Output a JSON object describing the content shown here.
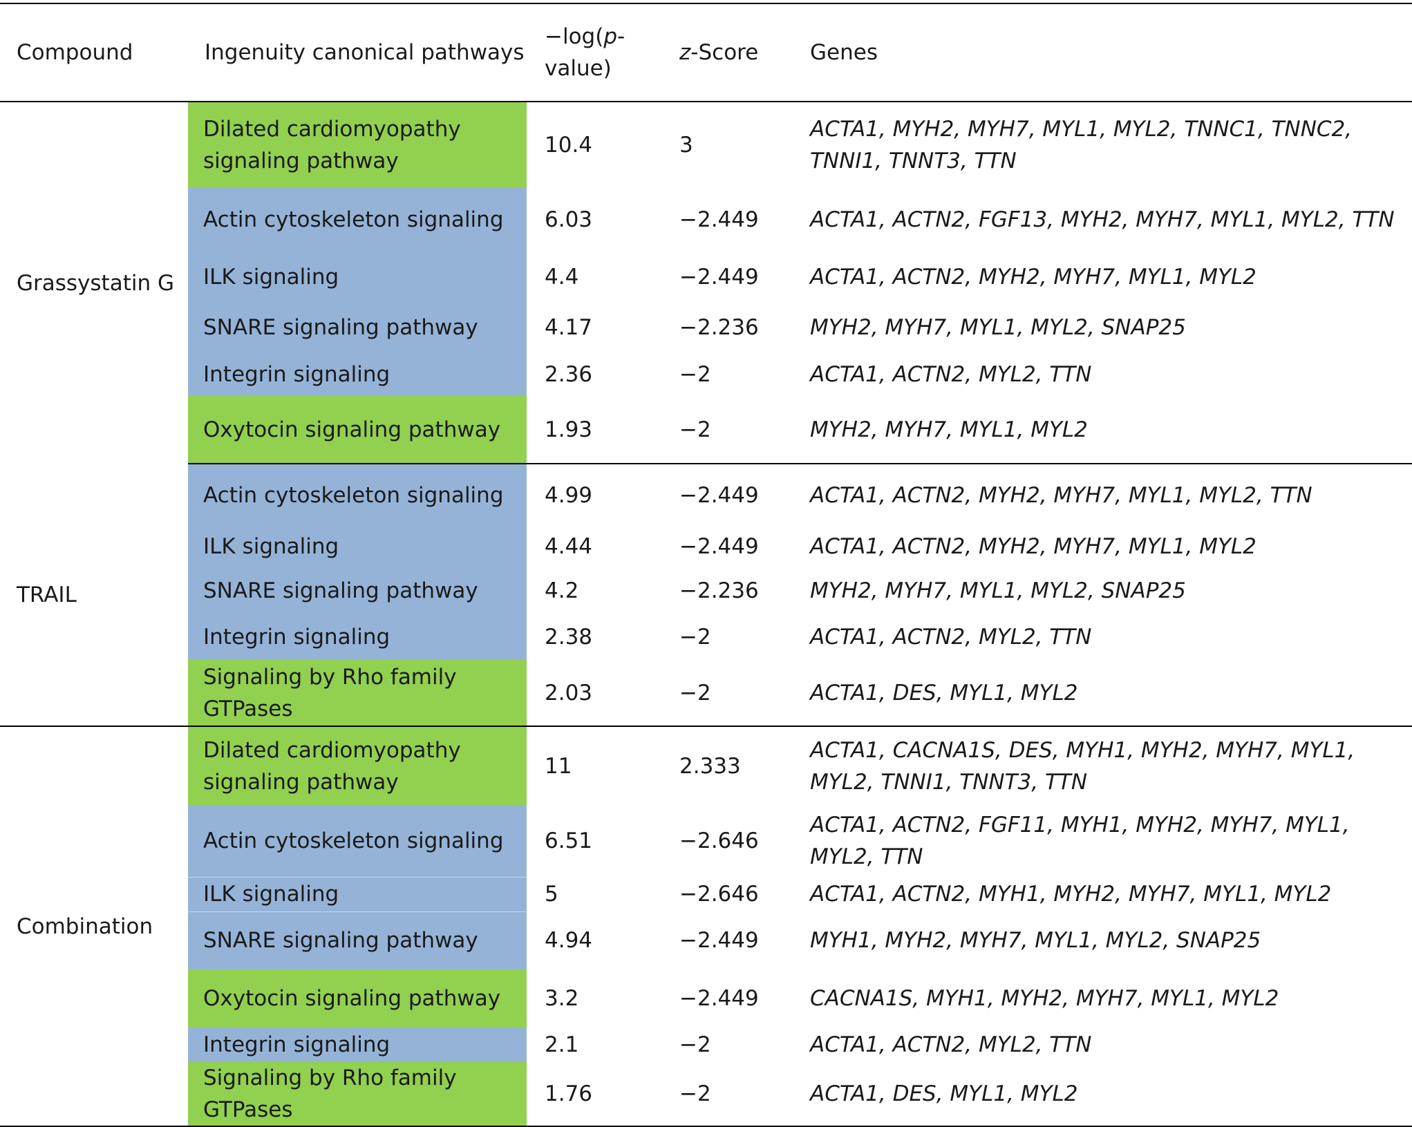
{
  "header": {
    "compound": "Compound",
    "pathways": "Ingenuity canonical pathways",
    "logp_prefix": "−log(",
    "logp_italic": "p",
    "logp_suffix": "-value)",
    "z_italic": "z",
    "z_suffix": "-Score",
    "genes": "Genes"
  },
  "colors": {
    "blue": "#95b3d7",
    "green": "#92d050"
  },
  "groups": [
    {
      "compound": "Grassystatin G",
      "rows": [
        {
          "pathway": "Dilated cardiomyopathy signaling pathway",
          "color": "green",
          "logp": "10.4",
          "z": "3",
          "genes": "ACTA1, MYH2, MYH7, MYL1, MYL2, TNNC1, TNNC2, TNNI1, TNNT3, TTN"
        },
        {
          "pathway": "Actin cytoskeleton signaling",
          "color": "blue",
          "logp": "6.03",
          "z": "−2.449",
          "genes": "ACTA1, ACTN2, FGF13, MYH2, MYH7, MYL1, MYL2, TTN"
        },
        {
          "pathway": "ILK signaling",
          "color": "blue",
          "logp": "4.4",
          "z": "−2.449",
          "genes": "ACTA1, ACTN2, MYH2, MYH7, MYL1, MYL2"
        },
        {
          "pathway": "SNARE signaling pathway",
          "color": "blue",
          "logp": "4.17",
          "z": "−2.236",
          "genes": "MYH2, MYH7, MYL1, MYL2, SNAP25"
        },
        {
          "pathway": "Integrin signaling",
          "color": "blue",
          "logp": "2.36",
          "z": "−2",
          "genes": "ACTA1, ACTN2, MYL2, TTN"
        },
        {
          "pathway": "Oxytocin signaling pathway",
          "color": "green",
          "logp": "1.93",
          "z": "−2",
          "genes": "MYH2, MYH7, MYL1, MYL2"
        }
      ]
    },
    {
      "compound": "TRAIL",
      "rows": [
        {
          "pathway": "Actin cytoskeleton signaling",
          "color": "blue",
          "logp": "4.99",
          "z": "−2.449",
          "genes": "ACTA1, ACTN2, MYH2, MYH7, MYL1, MYL2, TTN"
        },
        {
          "pathway": "ILK signaling",
          "color": "blue",
          "logp": "4.44",
          "z": "−2.449",
          "genes": "ACTA1, ACTN2, MYH2, MYH7, MYL1, MYL2"
        },
        {
          "pathway": "SNARE signaling pathway",
          "color": "blue",
          "logp": "4.2",
          "z": "−2.236",
          "genes": "MYH2, MYH7, MYL1, MYL2, SNAP25"
        },
        {
          "pathway": "Integrin signaling",
          "color": "blue",
          "logp": "2.38",
          "z": "−2",
          "genes": "ACTA1, ACTN2, MYL2, TTN"
        },
        {
          "pathway": "Signaling by Rho family GTPases",
          "color": "green",
          "logp": "2.03",
          "z": "−2",
          "genes": "ACTA1, DES, MYL1, MYL2"
        }
      ]
    },
    {
      "compound": "Combination",
      "rows": [
        {
          "pathway": "Dilated cardiomyopathy signaling pathway",
          "color": "green",
          "logp": "11",
          "z": "2.333",
          "genes": "ACTA1, CACNA1S, DES, MYH1, MYH2, MYH7, MYL1, MYL2, TNNI1, TNNT3, TTN"
        },
        {
          "pathway": "Actin cytoskeleton signaling",
          "color": "blue",
          "logp": "6.51",
          "z": "−2.646",
          "genes": "ACTA1, ACTN2, FGF11, MYH1, MYH2, MYH7, MYL1, MYL2, TTN"
        },
        {
          "pathway": "ILK signaling",
          "color": "blue",
          "logp": "5",
          "z": "−2.646",
          "genes": "ACTA1, ACTN2, MYH1, MYH2, MYH7, MYL1, MYL2"
        },
        {
          "pathway": "SNARE signaling pathway",
          "color": "blue",
          "logp": "4.94",
          "z": "−2.449",
          "genes": "MYH1, MYH2, MYH7, MYL1, MYL2, SNAP25"
        },
        {
          "pathway": "Oxytocin signaling pathway",
          "color": "green",
          "logp": "3.2",
          "z": "−2.449",
          "genes": "CACNA1S, MYH1, MYH2, MYH7, MYL1, MYL2"
        },
        {
          "pathway": "Integrin signaling",
          "color": "blue",
          "logp": "2.1",
          "z": "−2",
          "genes": "ACTA1, ACTN2, MYL2, TTN"
        },
        {
          "pathway": "Signaling by Rho family GTPases",
          "color": "green",
          "logp": "1.76",
          "z": "−2",
          "genes": "ACTA1, DES, MYL1, MYL2"
        }
      ]
    }
  ]
}
